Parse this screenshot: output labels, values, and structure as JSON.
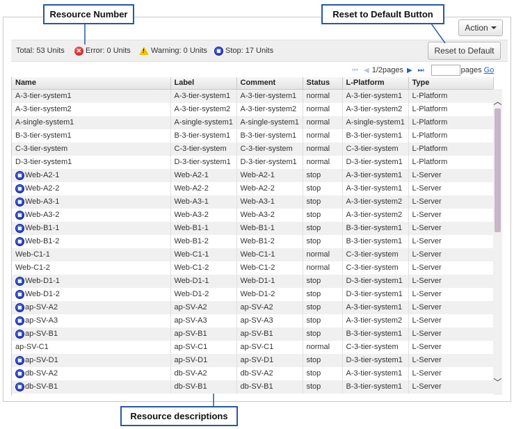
{
  "header": {
    "action_label": "Action"
  },
  "status_bar": {
    "total": "Total: 53 Units",
    "error": "Error: 0 Units",
    "warning": "Warning: 0 Units",
    "stop": "Stop: 17 Units"
  },
  "reset_button_label": "Reset to Default",
  "pager": {
    "page_text": "1/2pages",
    "pages_label": "pages",
    "go_label": "Go",
    "page_input_value": ""
  },
  "table": {
    "columns": [
      "Name",
      "Label",
      "Comment",
      "Status",
      "L-Platform",
      "Type"
    ],
    "rows": [
      {
        "stopped": false,
        "cells": [
          "A-3-tier-system1",
          "A-3-tier-system1",
          "A-3-tier-system1",
          "normal",
          "A-3-tier-system1",
          "L-Platform"
        ]
      },
      {
        "stopped": false,
        "cells": [
          "A-3-tier-system2",
          "A-3-tier-system2",
          "A-3-tier-system2",
          "normal",
          "A-3-tier-system2",
          "L-Platform"
        ]
      },
      {
        "stopped": false,
        "cells": [
          "A-single-system1",
          "A-single-system1",
          "A-single-system1",
          "normal",
          "A-single-system1",
          "L-Platform"
        ]
      },
      {
        "stopped": false,
        "cells": [
          "B-3-tier-system1",
          "B-3-tier-system1",
          "B-3-tier-system1",
          "normal",
          "B-3-tier-system1",
          "L-Platform"
        ]
      },
      {
        "stopped": false,
        "cells": [
          "C-3-tier-system",
          "C-3-tier-system",
          "C-3-tier-system",
          "normal",
          "C-3-tier-system",
          "L-Platform"
        ]
      },
      {
        "stopped": false,
        "cells": [
          "D-3-tier-system1",
          "D-3-tier-system1",
          "D-3-tier-system1",
          "normal",
          "D-3-tier-system1",
          "L-Platform"
        ]
      },
      {
        "stopped": true,
        "cells": [
          "Web-A2-1",
          "Web-A2-1",
          "Web-A2-1",
          "stop",
          "A-3-tier-system1",
          "L-Server"
        ]
      },
      {
        "stopped": true,
        "cells": [
          "Web-A2-2",
          "Web-A2-2",
          "Web-A2-2",
          "stop",
          "A-3-tier-system1",
          "L-Server"
        ]
      },
      {
        "stopped": true,
        "cells": [
          "Web-A3-1",
          "Web-A3-1",
          "Web-A3-1",
          "stop",
          "A-3-tier-system2",
          "L-Server"
        ]
      },
      {
        "stopped": true,
        "cells": [
          "Web-A3-2",
          "Web-A3-2",
          "Web-A3-2",
          "stop",
          "A-3-tier-system2",
          "L-Server"
        ]
      },
      {
        "stopped": true,
        "cells": [
          "Web-B1-1",
          "Web-B1-1",
          "Web-B1-1",
          "stop",
          "B-3-tier-system1",
          "L-Server"
        ]
      },
      {
        "stopped": true,
        "cells": [
          "Web-B1-2",
          "Web-B1-2",
          "Web-B1-2",
          "stop",
          "B-3-tier-system1",
          "L-Server"
        ]
      },
      {
        "stopped": false,
        "cells": [
          "Web-C1-1",
          "Web-C1-1",
          "Web-C1-1",
          "normal",
          "C-3-tier-system",
          "L-Server"
        ]
      },
      {
        "stopped": false,
        "cells": [
          "Web-C1-2",
          "Web-C1-2",
          "Web-C1-2",
          "normal",
          "C-3-tier-system",
          "L-Server"
        ]
      },
      {
        "stopped": true,
        "cells": [
          "Web-D1-1",
          "Web-D1-1",
          "Web-D1-1",
          "stop",
          "D-3-tier-system1",
          "L-Server"
        ]
      },
      {
        "stopped": true,
        "cells": [
          "Web-D1-2",
          "Web-D1-2",
          "Web-D1-2",
          "stop",
          "D-3-tier-system1",
          "L-Server"
        ]
      },
      {
        "stopped": true,
        "cells": [
          "ap-SV-A2",
          "ap-SV-A2",
          "ap-SV-A2",
          "stop",
          "A-3-tier-system1",
          "L-Server"
        ]
      },
      {
        "stopped": true,
        "cells": [
          "ap-SV-A3",
          "ap-SV-A3",
          "ap-SV-A3",
          "stop",
          "A-3-tier-system2",
          "L-Server"
        ]
      },
      {
        "stopped": true,
        "cells": [
          "ap-SV-B1",
          "ap-SV-B1",
          "ap-SV-B1",
          "stop",
          "B-3-tier-system1",
          "L-Server"
        ]
      },
      {
        "stopped": false,
        "cells": [
          "ap-SV-C1",
          "ap-SV-C1",
          "ap-SV-C1",
          "normal",
          "C-3-tier-system",
          "L-Server"
        ]
      },
      {
        "stopped": true,
        "cells": [
          "ap-SV-D1",
          "ap-SV-D1",
          "ap-SV-D1",
          "stop",
          "D-3-tier-system1",
          "L-Server"
        ]
      },
      {
        "stopped": true,
        "cells": [
          "db-SV-A2",
          "db-SV-A2",
          "db-SV-A2",
          "stop",
          "A-3-tier-system1",
          "L-Server"
        ]
      },
      {
        "stopped": true,
        "cells": [
          "db-SV-B1",
          "db-SV-B1",
          "db-SV-B1",
          "stop",
          "B-3-tier-system1",
          "L-Server"
        ]
      }
    ]
  },
  "callouts": {
    "resource_number": "Resource Number",
    "reset_default": "Reset to Default Button",
    "resource_descriptions": "Resource descriptions"
  },
  "icons": {
    "error": "error-icon",
    "warning": "warning-icon",
    "stop": "stop-icon"
  },
  "colors": {
    "callout_border": "#2457a8",
    "link": "#1e60c8",
    "scroll_thumb": "#c6b6c6"
  }
}
